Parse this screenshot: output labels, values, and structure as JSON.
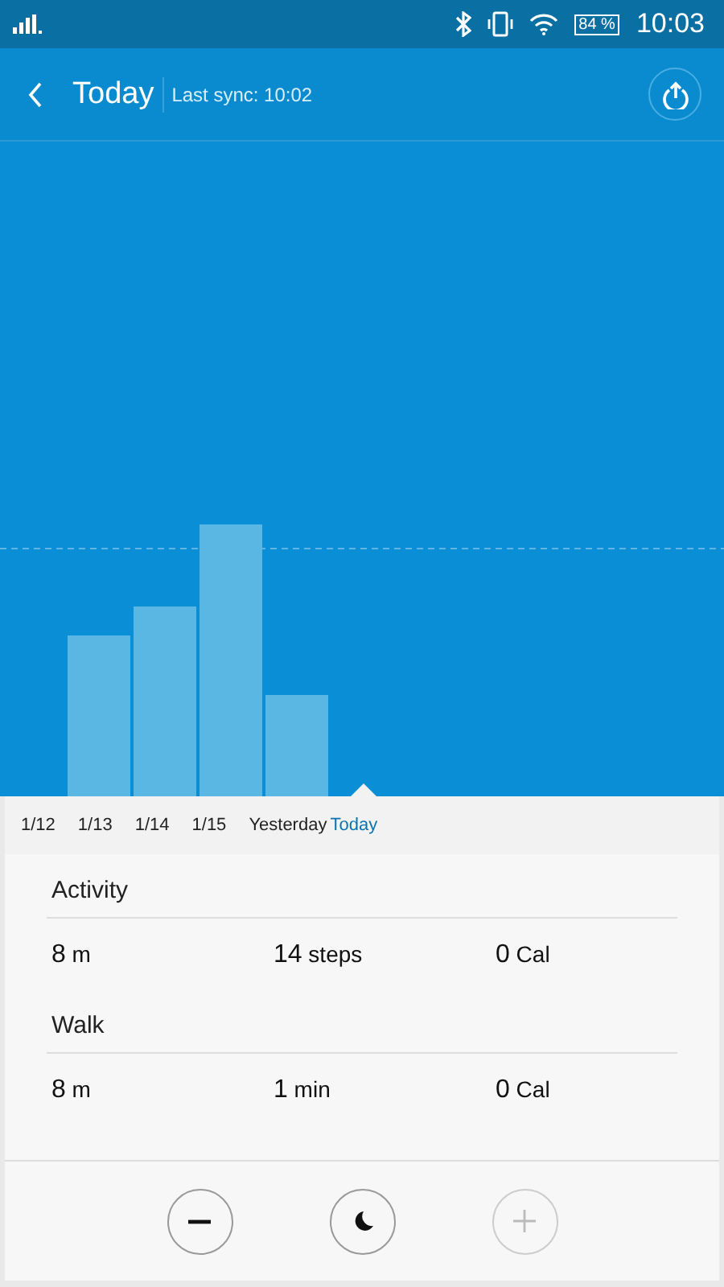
{
  "status_bar": {
    "battery": "84 %",
    "time": "10:03"
  },
  "header": {
    "title": "Today",
    "subtitle": "Last sync: 10:02"
  },
  "dates": [
    {
      "label": "1/12",
      "selected": false
    },
    {
      "label": "1/13",
      "selected": false
    },
    {
      "label": "1/14",
      "selected": false
    },
    {
      "label": "1/15",
      "selected": false
    },
    {
      "label": "Yesterday",
      "selected": false
    },
    {
      "label": "Today",
      "selected": true
    }
  ],
  "sections": [
    {
      "title": "Activity",
      "values": [
        {
          "number": "8",
          "unit": "m"
        },
        {
          "number": "14",
          "unit": "steps"
        },
        {
          "number": "0",
          "unit": "Cal"
        }
      ]
    },
    {
      "title": "Walk",
      "values": [
        {
          "number": "8",
          "unit": "m"
        },
        {
          "number": "1",
          "unit": "min"
        },
        {
          "number": "0",
          "unit": "Cal"
        }
      ]
    }
  ],
  "controls": [
    {
      "kind": "minus",
      "disabled": false
    },
    {
      "kind": "moon",
      "disabled": false
    },
    {
      "kind": "plus",
      "disabled": true
    }
  ]
}
